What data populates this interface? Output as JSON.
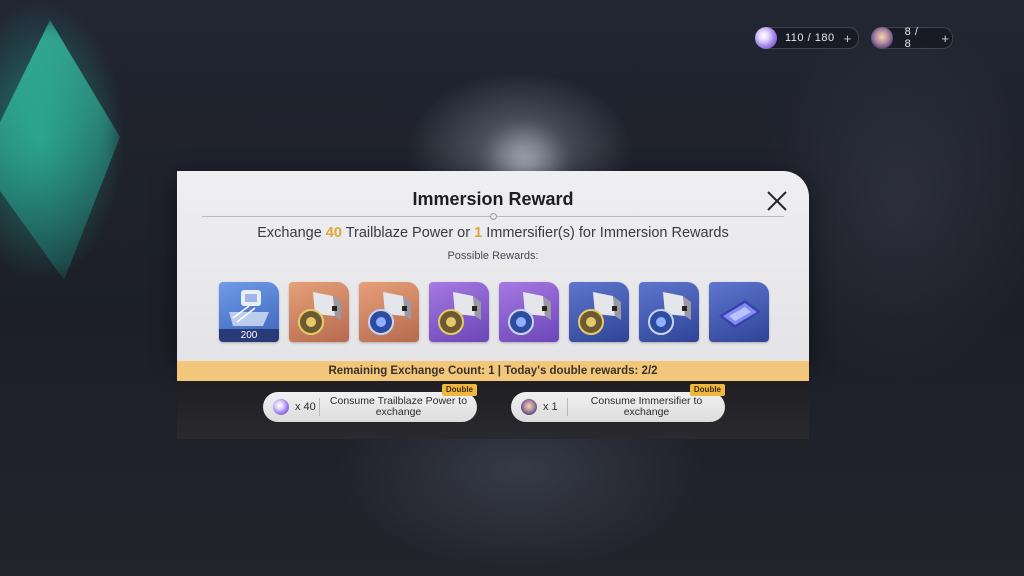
{
  "topbar": {
    "trailblaze_power": {
      "value": "110 / 180",
      "icon": "trailblaze-power-icon",
      "plus": "+"
    },
    "immersifier": {
      "value": "8 / 8",
      "icon": "immersifier-icon",
      "plus": "+"
    }
  },
  "dialog": {
    "title": "Immersion Reward",
    "subtitle": {
      "part1": "Exchange ",
      "tp_amount": "40",
      "part2": " Trailblaze Power or ",
      "im_amount": "1",
      "part3": " Immersifier(s) for Immersion Rewards"
    },
    "possible_label": "Possible Rewards:",
    "rewards": [
      {
        "icon": "exp-material-icon",
        "rarity": "blue",
        "qty": "200"
      },
      {
        "icon": "relic-sphere-icon",
        "rarity": "gold"
      },
      {
        "icon": "relic-rope-icon",
        "rarity": "gold"
      },
      {
        "icon": "relic-sphere-icon",
        "rarity": "purple"
      },
      {
        "icon": "relic-rope-icon",
        "rarity": "purple"
      },
      {
        "icon": "relic-sphere-icon",
        "rarity": "navy"
      },
      {
        "icon": "relic-rope-icon",
        "rarity": "navy"
      },
      {
        "icon": "relic-remains-icon",
        "rarity": "navy"
      }
    ],
    "exchange_info": "Remaining Exchange Count: 1 | Today's double rewards: 2/2",
    "buttons": {
      "consume_tp": {
        "cost": "x 40",
        "label": "Consume Trailblaze Power to exchange",
        "badge": "Double",
        "icon": "trailblaze-power-icon"
      },
      "consume_im": {
        "cost": "x 1",
        "label": "Consume Immersifier to exchange",
        "badge": "Double",
        "icon": "immersifier-icon"
      }
    }
  },
  "colors": {
    "highlight": "#e0a63a",
    "exchange_bar": "#f2c77b",
    "badge": "#f0b73f"
  }
}
